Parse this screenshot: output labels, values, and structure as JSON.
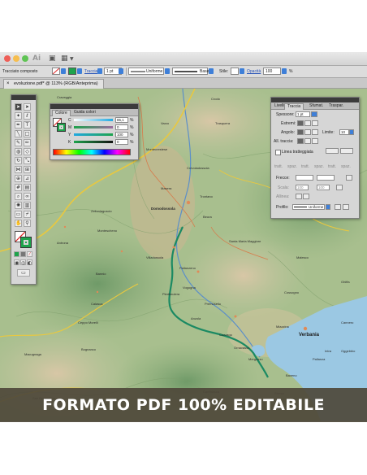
{
  "window": {
    "tab_title": "evoluzione.pdf* @ 113% (RGB/Anteprima)",
    "traffic_lights": [
      "#ee5f58",
      "#f6be4f",
      "#5fc454"
    ]
  },
  "control_bar": {
    "object_type": "Tracciato composto",
    "stroke_label": "Traccia",
    "stroke_weight": "1 pt",
    "profile": "Uniforme",
    "brush": "Base",
    "style_label": "Stile:",
    "opacity_label": "Opacità",
    "opacity_value": "100",
    "percent": "%"
  },
  "color_panel": {
    "tab_active": "Colore",
    "tab_other": "Guida colori",
    "channels": [
      {
        "letter": "C",
        "value": "85,1",
        "color": "#21a9e1"
      },
      {
        "letter": "M",
        "value": "0",
        "color": "#e0248a"
      },
      {
        "letter": "Y",
        "value": "100",
        "color": "#f3e100"
      },
      {
        "letter": "K",
        "value": "0",
        "color": "#222222"
      }
    ],
    "percent": "%"
  },
  "stroke_panel": {
    "tabs": [
      "Livelli",
      "Traccia",
      "Sfumat.",
      "Traspar."
    ],
    "active_tab": "Traccia",
    "weight_label": "Spessore:",
    "weight_value": "1 pt",
    "cap_label": "Estremi:",
    "corner_label": "Angolo:",
    "limit_label": "Limite:",
    "limit_value": "10",
    "align_label": "All. traccia:",
    "dashed_label": "Linea tratteggiata",
    "dash_headers": [
      "tratt.",
      "spaz.",
      "tratt.",
      "spaz.",
      "tratt.",
      "spaz."
    ],
    "arrow_label": "Frecce:",
    "scale_label": "Scala:",
    "scale_values": [
      "100",
      "100"
    ],
    "align_arrow_label": "Allinea:",
    "profile_label": "Profilo:",
    "profile_value": "Uniforme"
  },
  "map": {
    "places": [
      "Craveggia",
      "Zellonlaguscio",
      "Domodossola",
      "Trontano",
      "Villadossola",
      "Premosello",
      "Pallanzeno",
      "Ornavasso",
      "Mergozzo",
      "Verbania",
      "Vogogna",
      "Piedimulera",
      "Bannio",
      "Ceppo Morelli",
      "Macugnaga",
      "Anzola",
      "Cossogno",
      "Santa Maria Maggiore",
      "Malesco",
      "Ghiffa",
      "Baveno",
      "Stresa",
      "Cannero",
      "Oggebbio",
      "Calasca",
      "Antrona",
      "Montescheno",
      "Masera",
      "Beura",
      "Cuzzago",
      "Miazzina",
      "Intra",
      "Pallanza",
      "Varzo",
      "Trasquera",
      "Crevoladossola",
      "Crodo",
      "Montecrestese",
      "Bognanco",
      "San Bernardino",
      "Premeno",
      "Cambiasca"
    ],
    "city": "Verbania",
    "water_color": "#9bc8e3",
    "trail_color": "#1b8a63"
  },
  "banner": {
    "text": "FORMATO PDF 100% EDITABILE"
  }
}
